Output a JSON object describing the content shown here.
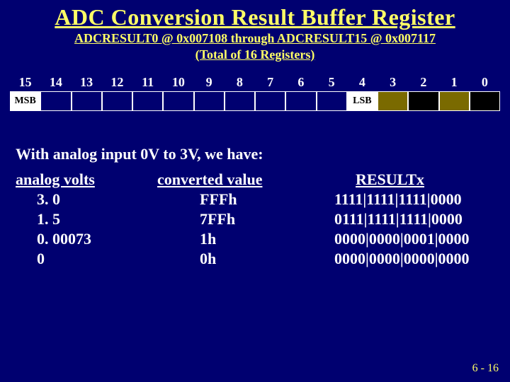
{
  "title": "ADC Conversion Result Buffer Register",
  "subtitle_line1": "ADCRESULT0 @ 0x007108  through  ADCRESULT15 @ 0x007117",
  "subtitle_line2": "(Total of 16 Registers)",
  "bits": [
    "15",
    "14",
    "13",
    "12",
    "11",
    "10",
    "9",
    "8",
    "7",
    "6",
    "5",
    "4",
    "3",
    "2",
    "1",
    "0"
  ],
  "msb_label": "MSB",
  "lsb_label": "LSB",
  "body_line": "With analog input 0V to 3V, we have:",
  "table": {
    "headers": {
      "c1": "analog volts",
      "c2": "converted value",
      "c3": "RESULTx"
    },
    "rows": [
      {
        "volts": "3. 0",
        "hex": "FFFh",
        "bin": "1111|1111|1111|0000"
      },
      {
        "volts": "1. 5",
        "hex": "7FFh",
        "bin": "0111|1111|1111|0000"
      },
      {
        "volts": "0. 00073",
        "hex": "1h",
        "bin": "0000|0000|0001|0000"
      },
      {
        "volts": "0",
        "hex": "0h",
        "bin": "0000|0000|0000|0000"
      }
    ]
  },
  "footer": "6 - 16"
}
